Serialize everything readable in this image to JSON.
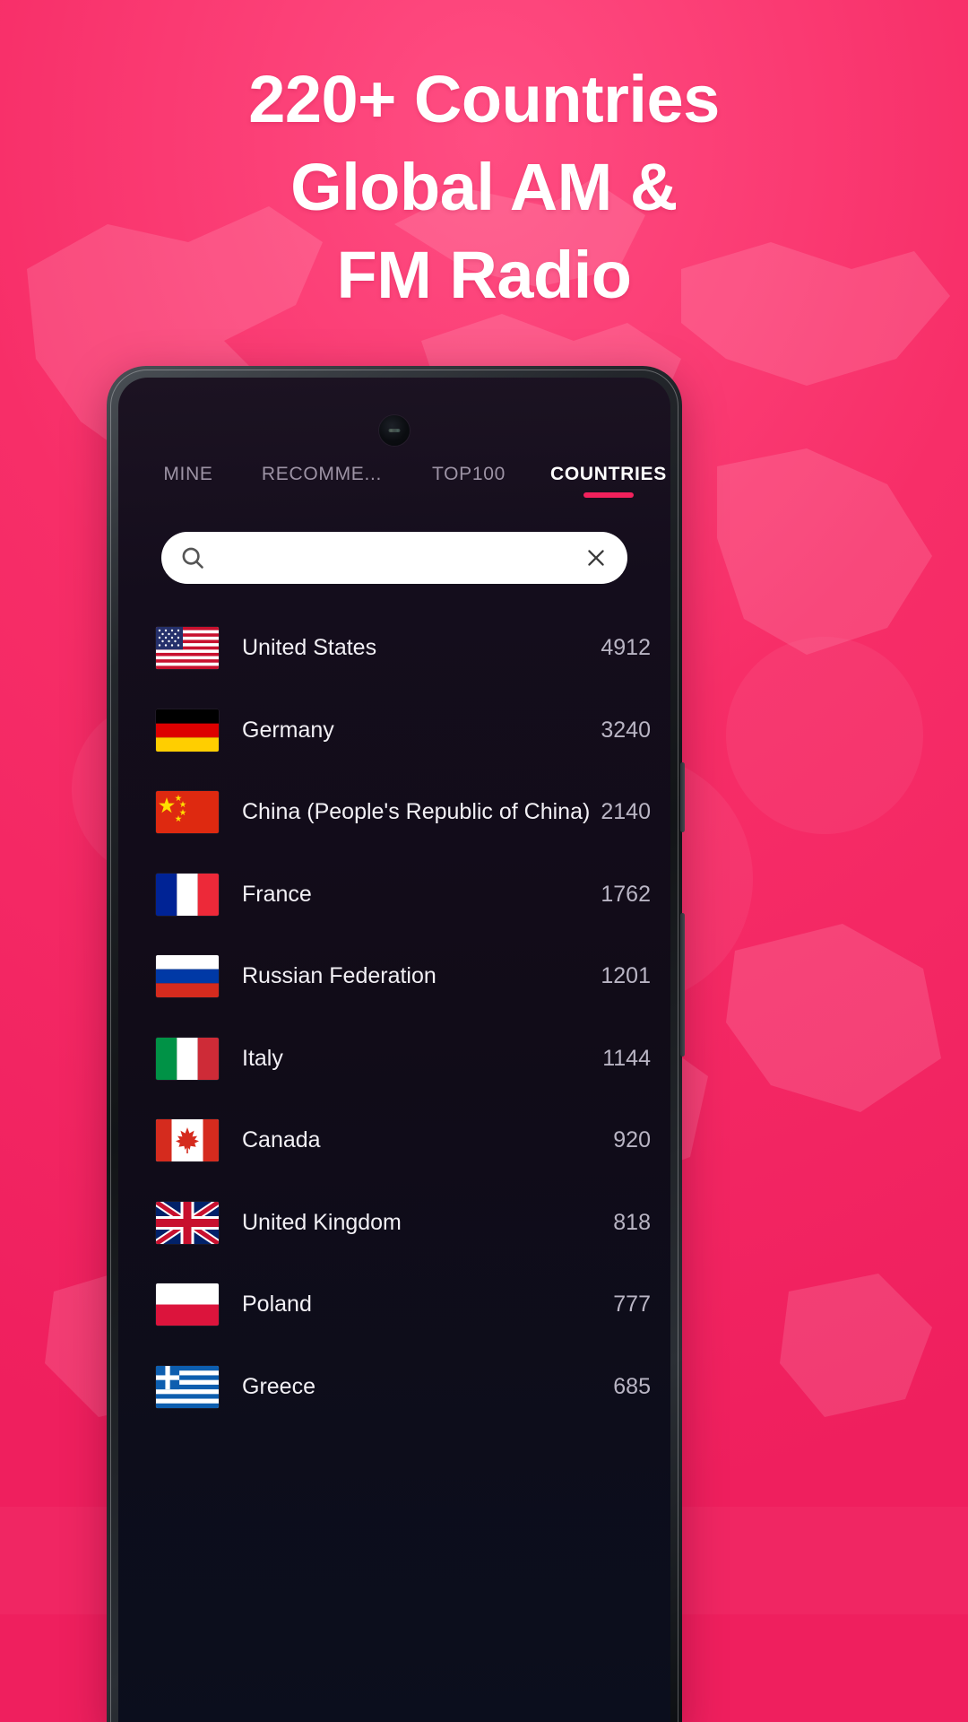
{
  "promo": {
    "headline_lines": [
      "220+ Countries",
      "Global AM &",
      "FM Radio"
    ],
    "background_color": "#f0386b",
    "accent_color": "#f1215c"
  },
  "app": {
    "tabs": [
      {
        "label": "MINE",
        "active": false
      },
      {
        "label": "RECOMME...",
        "active": false
      },
      {
        "label": "TOP100",
        "active": false
      },
      {
        "label": "COUNTRIES",
        "active": true
      }
    ],
    "search": {
      "value": "",
      "placeholder": "",
      "search_icon": "search-icon",
      "clear_icon": "close-icon"
    },
    "countries": [
      {
        "name": "United States",
        "count": "4912",
        "flag": "us"
      },
      {
        "name": "Germany",
        "count": "3240",
        "flag": "de"
      },
      {
        "name": "China (People's Republic of China)",
        "count": "2140",
        "flag": "cn"
      },
      {
        "name": "France",
        "count": "1762",
        "flag": "fr"
      },
      {
        "name": "Russian Federation",
        "count": "1201",
        "flag": "ru"
      },
      {
        "name": "Italy",
        "count": "1144",
        "flag": "it"
      },
      {
        "name": "Canada",
        "count": "920",
        "flag": "ca"
      },
      {
        "name": "United Kingdom",
        "count": "818",
        "flag": "gb"
      },
      {
        "name": "Poland",
        "count": "777",
        "flag": "pl"
      },
      {
        "name": "Greece",
        "count": "685",
        "flag": "gr"
      }
    ]
  }
}
